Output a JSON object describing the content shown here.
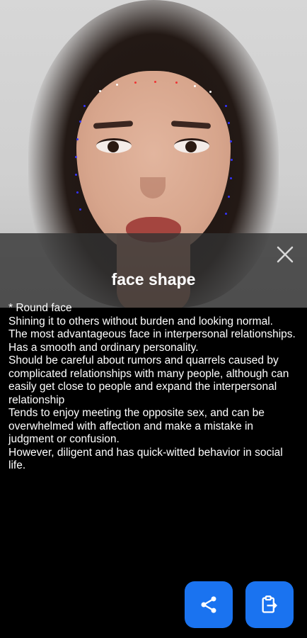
{
  "dialog": {
    "title": "face shape",
    "close_icon": "close-icon"
  },
  "description": {
    "lines": [
      "* Round face",
      "Shining it to others without burden and looking normal.",
      "The most advantageous face in interpersonal relationships.",
      "Has a smooth and ordinary personality.",
      "Should be careful about rumors and quarrels caused by complicated relationships with many people, although can easily get close to people and expand the interpersonal relationship",
      "Tends to enjoy meeting the opposite sex, and can be overwhelmed with affection and make a mistake in judgment or confusion.",
      "However, diligent and has quick-witted behavior in social life."
    ]
  },
  "actions": {
    "share_icon": "share-icon",
    "copy_icon": "clipboard-copy-icon",
    "accent_color": "#1a73f0"
  }
}
